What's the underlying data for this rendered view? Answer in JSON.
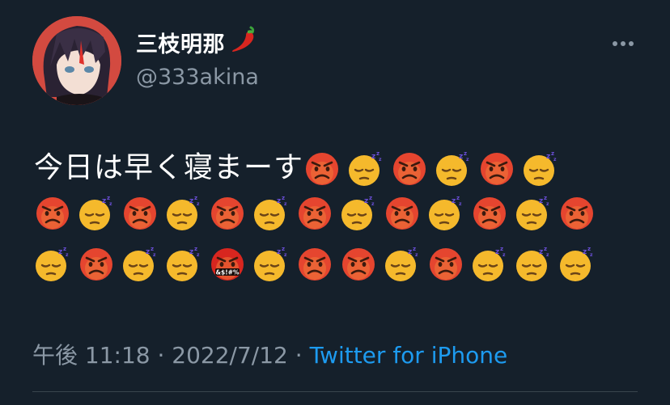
{
  "user": {
    "display_name": "三枝明那",
    "name_emoji": "chili-pepper",
    "handle": "@333akina"
  },
  "tweet": {
    "text": "今日は早く寝まーす",
    "emoji_lines": [
      [
        "angry",
        "sleeping",
        "angry",
        "sleeping",
        "angry",
        "sleeping"
      ],
      [
        "angry",
        "sleeping",
        "angry",
        "sleeping",
        "angry",
        "sleeping",
        "angry",
        "sleeping",
        "angry",
        "sleeping",
        "angry",
        "sleeping",
        "angry"
      ],
      [
        "sleeping",
        "angry",
        "sleeping",
        "sleeping",
        "cursing",
        "sleeping",
        "angry",
        "angry",
        "sleeping",
        "angry",
        "sleeping",
        "sleeping",
        "sleeping"
      ]
    ]
  },
  "meta": {
    "time": "午後 11:18",
    "sep1": " · ",
    "date": "2022/7/12",
    "sep2": " · ",
    "source": "Twitter for iPhone"
  },
  "colors": {
    "background": "#15202b",
    "text": "#ffffff",
    "muted": "#8b98a5",
    "link": "#1d9bf0",
    "angry_face": "#e5452f",
    "sleepy_face": "#f5b92c"
  },
  "icons": {
    "more": "more-dots-icon"
  }
}
